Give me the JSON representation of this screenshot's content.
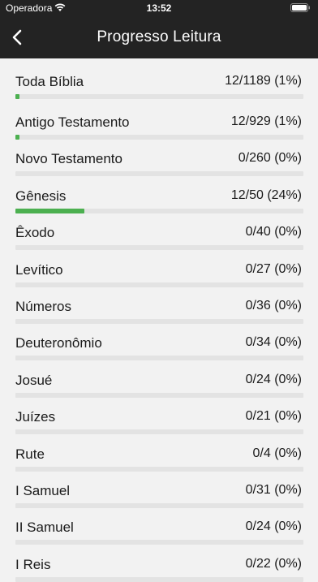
{
  "status_bar": {
    "carrier": "Operadora",
    "time": "13:52"
  },
  "header": {
    "title": "Progresso Leitura",
    "back_icon": "chevron-left-icon"
  },
  "colors": {
    "header_bg": "#232323",
    "progress_fill": "#4cb050",
    "progress_track": "#e3e3e3"
  },
  "items": [
    {
      "label": "Toda Bíblia",
      "count": "12/1189 (1%)",
      "progress": 0.01
    },
    {
      "label": "Antigo Testamento",
      "count": "12/929 (1%)",
      "progress": 0.013
    },
    {
      "label": "Novo Testamento",
      "count": "0/260 (0%)",
      "progress": 0
    },
    {
      "label": "Gênesis",
      "count": "12/50 (24%)",
      "progress": 0.24
    },
    {
      "label": "Êxodo",
      "count": "0/40 (0%)",
      "progress": 0
    },
    {
      "label": "Levítico",
      "count": "0/27 (0%)",
      "progress": 0
    },
    {
      "label": "Números",
      "count": "0/36 (0%)",
      "progress": 0
    },
    {
      "label": "Deuteronômio",
      "count": "0/34 (0%)",
      "progress": 0
    },
    {
      "label": "Josué",
      "count": "0/24 (0%)",
      "progress": 0
    },
    {
      "label": "Juízes",
      "count": "0/21 (0%)",
      "progress": 0
    },
    {
      "label": "Rute",
      "count": "0/4 (0%)",
      "progress": 0
    },
    {
      "label": "I Samuel",
      "count": "0/31 (0%)",
      "progress": 0
    },
    {
      "label": "II Samuel",
      "count": "0/24 (0%)",
      "progress": 0
    },
    {
      "label": "I Reis",
      "count": "0/22 (0%)",
      "progress": 0
    }
  ]
}
